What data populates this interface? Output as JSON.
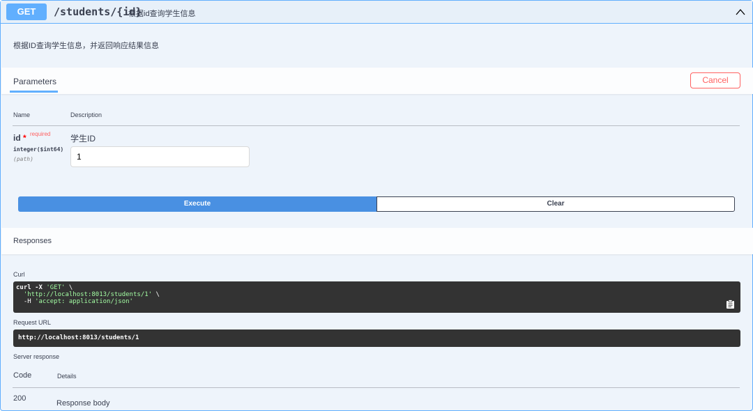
{
  "operation": {
    "method": "GET",
    "path": "/students/{id}",
    "summary": "根据id查询学生信息",
    "description": "根据ID查询学生信息，并返回响应结果信息",
    "collapse_icon": "chevron-up-icon"
  },
  "parameters": {
    "tab_label": "Parameters",
    "cancel_label": "Cancel",
    "columns": [
      "Name",
      "Description"
    ],
    "items": [
      {
        "name": "id",
        "required_star": "*",
        "required_label": "required",
        "type": "integer($int64)",
        "in": "(path)",
        "description": "学生ID",
        "value": "1"
      }
    ]
  },
  "actions": {
    "execute_label": "Execute",
    "clear_label": "Clear"
  },
  "responses": {
    "title": "Responses",
    "curl_label": "Curl",
    "curl": {
      "line1_cmd": "curl -X ",
      "line1_method": "'GET'",
      "line1_tail": " \\",
      "line2_indent": "  ",
      "line2_url": "'http://localhost:8013/students/1'",
      "line2_tail": " \\",
      "line3_indent": "  -H ",
      "line3_header": "'accept: application/json'"
    },
    "request_url_label": "Request URL",
    "request_url": "http://localhost:8013/students/1",
    "server_response_label": "Server response",
    "columns": [
      "Code",
      "Details"
    ],
    "rows": [
      {
        "code": "200",
        "details": "Response body"
      }
    ]
  },
  "colors": {
    "get_accent": "#61affe",
    "execute": "#4990e2",
    "cancel": "#ff6060",
    "code_bg": "#333333"
  }
}
